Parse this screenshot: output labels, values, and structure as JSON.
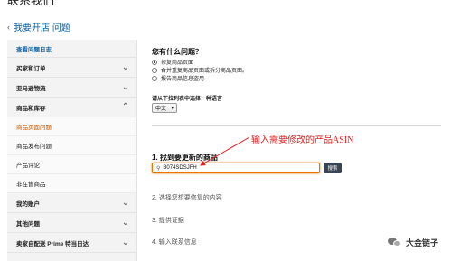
{
  "header": {
    "title": "联系我们",
    "breadcrumb": "我要开店 问题"
  },
  "sidebar": {
    "items": [
      {
        "label": "查看问题日志",
        "type": "top"
      },
      {
        "label": "买家和订单",
        "type": "collapsed"
      },
      {
        "label": "亚马逊物流",
        "type": "collapsed"
      },
      {
        "label": "商品和库存",
        "type": "expanded"
      },
      {
        "label": "商品页面问题",
        "type": "sub-active"
      },
      {
        "label": "商品发布问题",
        "type": "sub"
      },
      {
        "label": "产品评论",
        "type": "sub"
      },
      {
        "label": "非在售商品",
        "type": "sub"
      },
      {
        "label": "我的账户",
        "type": "collapsed"
      },
      {
        "label": "其他问题",
        "type": "collapsed"
      },
      {
        "label": "卖家自配送 Prime 特当日达",
        "type": "collapsed"
      }
    ]
  },
  "main": {
    "question_title": "您有什么问题？",
    "options": [
      {
        "label": "修复商品页面",
        "checked": true
      },
      {
        "label": "合并重复商品页面或拆分商品页面。",
        "checked": false
      },
      {
        "label": "报告商品信息盗用",
        "checked": false
      }
    ],
    "language_label": "请从下拉列表中选择一种语言",
    "language_value": "中文",
    "step1_title": "1. 找到要更新的商品",
    "asin_value": "B074SDSJFH",
    "search_label": "搜索",
    "step2": "2. 选择您想要修复的内容",
    "step3": "3. 提供证据",
    "step4": "4. 输入联系信息"
  },
  "annotation": {
    "text": "输入需要修改的产品ASIN",
    "color": "#e02020"
  },
  "watermark": {
    "text": "大金链子"
  },
  "colors": {
    "link": "#0a62a8",
    "active": "#c45500",
    "input_focus": "#e77600",
    "button": "#3a4553"
  }
}
